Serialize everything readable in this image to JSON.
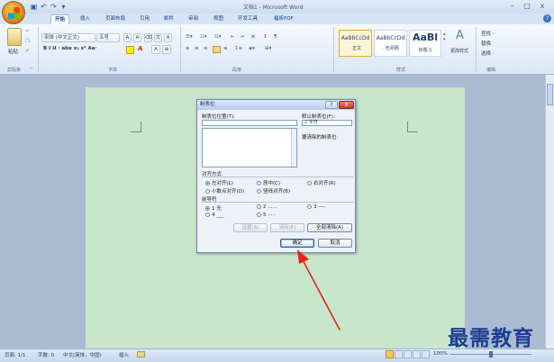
{
  "window": {
    "title": "文档1 - Microsoft Word",
    "controls": {
      "minimize": "–",
      "maximize": "□",
      "close": "x"
    }
  },
  "quick_access": [
    "▣",
    "↶",
    "↷",
    "▾"
  ],
  "tabs": [
    {
      "label": "开始",
      "active": true
    },
    {
      "label": "插入"
    },
    {
      "label": "页面布局"
    },
    {
      "label": "引用"
    },
    {
      "label": "邮件"
    },
    {
      "label": "审阅"
    },
    {
      "label": "视图"
    },
    {
      "label": "开发工具"
    },
    {
      "label": "福昕PDF"
    }
  ],
  "ribbon": {
    "clipboard": {
      "paste": "粘贴",
      "label": "剪贴板"
    },
    "font": {
      "name": "宋体 (中文正文)",
      "size": "五号",
      "format_row": "B  I  U · abe  x₂  x²  Aa·",
      "label": "字体"
    },
    "paragraph": {
      "label": "段落"
    },
    "styles": {
      "items": [
        {
          "sample": "AaBbCcDd",
          "name": "· 正文"
        },
        {
          "sample": "AaBbCcDd",
          "name": "· 无间隔"
        },
        {
          "sample": "AaBl",
          "name": "标题 1"
        }
      ],
      "change_styles": "更改样式",
      "label": "样式"
    },
    "editing": {
      "find": "查找 ·",
      "replace": "替换",
      "select": "选择 ·",
      "label": "编辑"
    }
  },
  "dialog": {
    "title": "制表位",
    "help": "?",
    "close": "X",
    "tab_stop_label": "制表位位置(T):",
    "default_label": "默认制表位(F):",
    "default_value": "2 字符",
    "clear_label": "要清除的制表位:",
    "alignment": {
      "label": "对齐方式",
      "options": [
        {
          "label": "左对齐(L)",
          "checked": true
        },
        {
          "label": "居中(C)"
        },
        {
          "label": "右对齐(R)"
        },
        {
          "label": "小数点对齐(D)"
        },
        {
          "label": "竖线对齐(B)"
        }
      ]
    },
    "leader": {
      "label": "前导符",
      "options": [
        {
          "label": "1 无",
          "checked": true
        },
        {
          "label": "2 ......"
        },
        {
          "label": "3 ----"
        },
        {
          "label": "4 ___"
        },
        {
          "label": "5 ·····"
        }
      ]
    },
    "buttons": {
      "set": "设置(S)",
      "clear": "清除(E)",
      "clear_all": "全部清除(A)",
      "ok": "确定",
      "cancel": "取消"
    }
  },
  "statusbar": {
    "page": "页面: 1/1",
    "words": "字数: 0",
    "language": "中文(简体，中国)",
    "mode": "插入",
    "zoom": "100%"
  },
  "watermark": "最需教育",
  "colors": {
    "page": "#c8e6cb",
    "arrow": "#e8231a",
    "accent": "#15428b"
  }
}
